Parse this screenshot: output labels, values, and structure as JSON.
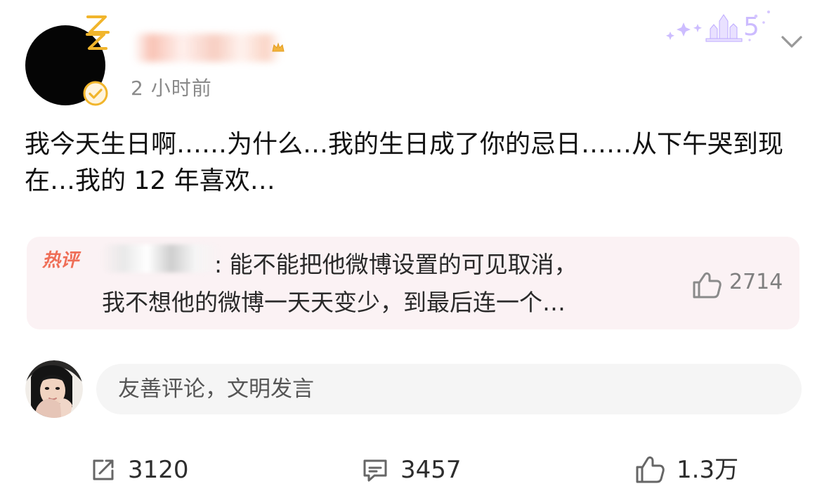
{
  "post": {
    "timestamp": "2 小时前",
    "text": "我今天生日啊……为什么…我的生日成了你的忌日……从下午哭到现在…我的 12 年喜欢…"
  },
  "hot_comment": {
    "badge": "热评",
    "line1": ": 能不能把他微博设置的可见取消，",
    "line2": "我不想他的微博一天天变少，到最后连一个…",
    "like_count": "2714"
  },
  "comment_box": {
    "placeholder": "友善评论，文明发言"
  },
  "actions": {
    "repost": "3120",
    "comment": "3457",
    "like": "1.3万"
  },
  "icons": {
    "top_right": "decor-icon",
    "menu": "chevron-down-icon",
    "repost": "share-icon",
    "comment": "comment-icon",
    "like": "thumb-up-icon"
  }
}
